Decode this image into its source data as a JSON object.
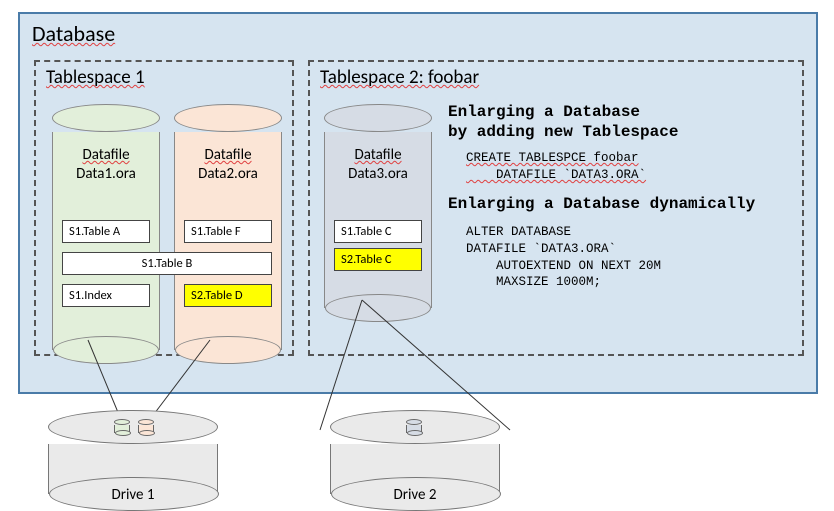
{
  "database": {
    "title": "Database"
  },
  "tablespace1": {
    "title": "Tablespace 1",
    "datafile1": {
      "name": "Datafile",
      "file": "Data1.ora",
      "tables": {
        "a": "S1.Table A",
        "index": "S1.Index"
      }
    },
    "datafile2": {
      "name": "Datafile",
      "file": "Data2.ora",
      "tables": {
        "f": "S1.Table F",
        "d": "S2.Table D"
      }
    },
    "shared_table_b": "S1.Table B"
  },
  "tablespace2": {
    "title": "Tablespace 2: foobar",
    "datafile3": {
      "name": "Datafile",
      "file": "Data3.ora",
      "tables": {
        "c1": "S1.Table C",
        "c2": "S2.Table C"
      }
    },
    "heading1": "Enlarging a Database\nby adding new Tablespace",
    "code1": "CREATE TABLESPCE foobar\n    DATAFILE `DATA3.ORA`",
    "heading2": "Enlarging a Database dynamically",
    "code2": "ALTER DATABASE\nDATAFILE `DATA3.ORA`\n    AUTOEXTEND ON NEXT 20M\n    MAXSIZE 1000M;"
  },
  "drives": {
    "d1": "Drive 1",
    "d2": "Drive 2"
  }
}
